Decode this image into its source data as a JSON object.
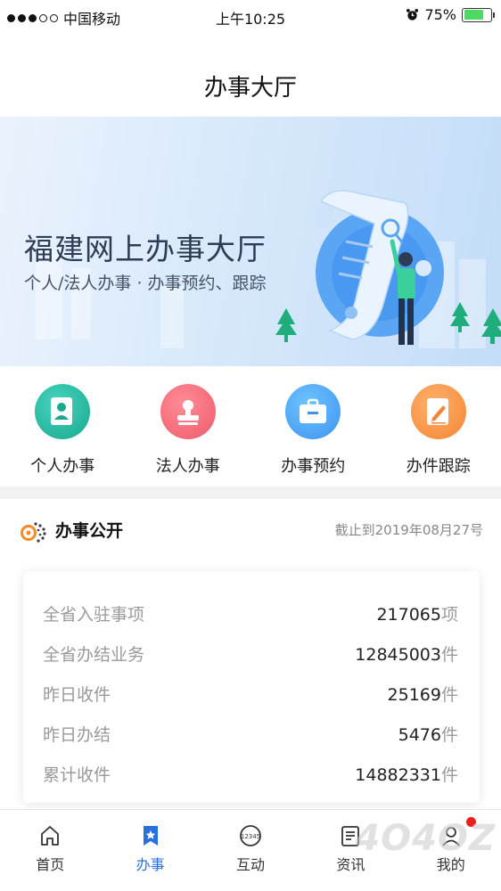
{
  "status_bar": {
    "carrier": "中国移动",
    "time": "上午10:25",
    "battery": "75%"
  },
  "page_title": "办事大厅",
  "banner": {
    "title": "福建网上办事大厅",
    "subtitle": "个人/法人办事 · 办事预约、跟踪"
  },
  "actions": [
    {
      "label": "个人办事",
      "icon": "personal-doc-icon",
      "color": "#1aa890"
    },
    {
      "label": "法人办事",
      "icon": "stamp-icon",
      "color": "#ef5a6a"
    },
    {
      "label": "办事预约",
      "icon": "briefcase-icon",
      "color": "#3d94ef"
    },
    {
      "label": "办件跟踪",
      "icon": "edit-doc-icon",
      "color": "#f58535"
    }
  ],
  "public_section": {
    "title": "办事公开",
    "date": "截止到2019年08月27号",
    "rows": [
      {
        "label": "全省入驻事项",
        "value": "217065",
        "unit": "项"
      },
      {
        "label": "全省办结业务",
        "value": "12845003",
        "unit": "件"
      },
      {
        "label": "昨日收件",
        "value": "25169",
        "unit": "件"
      },
      {
        "label": "昨日办结",
        "value": "5476",
        "unit": "件"
      },
      {
        "label": "累计收件",
        "value": "14882331",
        "unit": "件"
      }
    ]
  },
  "tabbar": {
    "items": [
      {
        "label": "首页",
        "icon": "home-icon"
      },
      {
        "label": "办事",
        "icon": "star-bookmark-icon",
        "active": true
      },
      {
        "label": "互动",
        "icon": "hotline-icon"
      },
      {
        "label": "资讯",
        "icon": "news-icon"
      },
      {
        "label": "我的",
        "icon": "user-icon"
      }
    ],
    "accent_color": "#2a6fde"
  },
  "watermark": "4O4OZ"
}
